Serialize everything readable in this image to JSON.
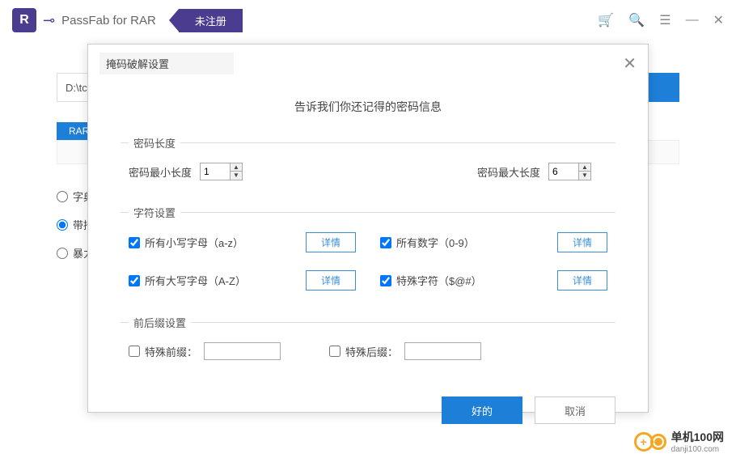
{
  "titlebar": {
    "app_title": "PassFab for RAR",
    "unregistered": "未注册"
  },
  "bg": {
    "path": "D:\\tc",
    "rar_tab": "RAR",
    "radios": {
      "r1": "字典",
      "r2": "带掩",
      "r3": "暴力"
    }
  },
  "modal": {
    "title": "掩码破解设置",
    "subtitle": "告诉我们你还记得的密码信息",
    "length": {
      "legend": "密码长度",
      "min_label": "密码最小长度",
      "min_value": "1",
      "max_label": "密码最大长度",
      "max_value": "6"
    },
    "chars": {
      "legend": "字符设置",
      "lowercase": "所有小写字母（a-z）",
      "uppercase": "所有大写字母（A-Z）",
      "digits": "所有数字（0-9）",
      "special": "特殊字符（$@#）",
      "detail": "详情"
    },
    "affix": {
      "legend": "前后缀设置",
      "prefix_label": "特殊前缀：",
      "suffix_label": "特殊后缀：",
      "prefix_value": "",
      "suffix_value": ""
    },
    "buttons": {
      "ok": "好的",
      "cancel": "取消"
    }
  },
  "watermark": {
    "name": "单机100网",
    "url": "danji100.com"
  }
}
